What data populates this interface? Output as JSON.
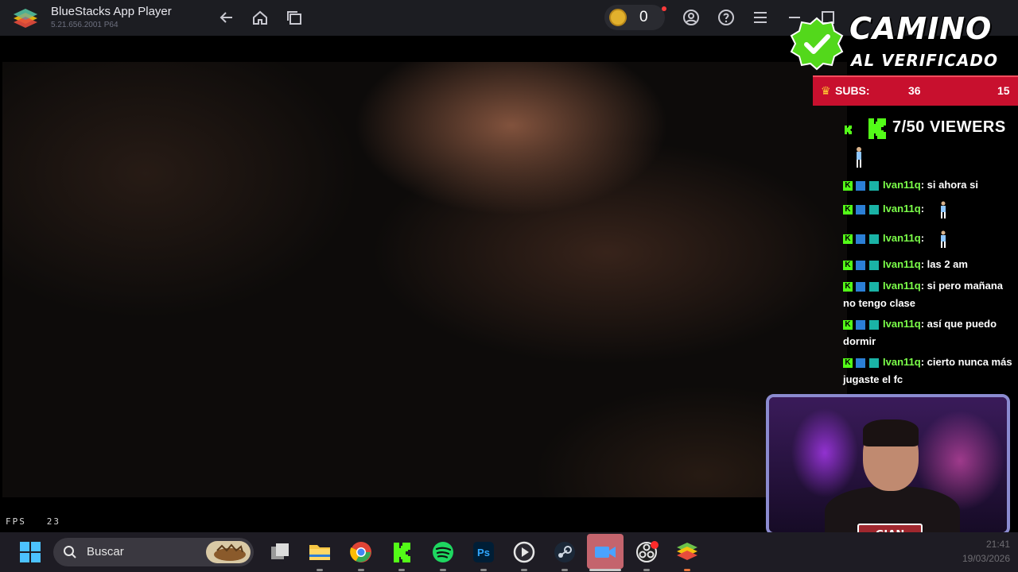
{
  "window": {
    "title": "BlueStacks App Player",
    "version": "5.21.656.2001 P64"
  },
  "toolbar": {
    "coins": "0"
  },
  "game": {
    "fps_label": "FPS",
    "fps_value": "23"
  },
  "overlay": {
    "title_line1": "CAMINO",
    "title_line2": "AL VERIFICADO",
    "subs_label": "SUBS:",
    "subs_value": "36",
    "subs_goal": "15",
    "viewers": "7/50 VIEWERS"
  },
  "chat": {
    "messages": [
      {
        "user": "Ivan11q",
        "text": ": si ahora si"
      },
      {
        "user": "Ivan11q",
        "text": ":"
      },
      {
        "user": "Ivan11q",
        "text": ":"
      },
      {
        "user": "Ivan11q",
        "text": ": las 2 am"
      },
      {
        "user": "Ivan11q",
        "text": ": si pero mañana no tengo clase"
      },
      {
        "user": "Ivan11q",
        "text": ": así que puedo dormir"
      },
      {
        "user": "Ivan11q",
        "text": ": cierto nunca más jugaste el fc"
      }
    ]
  },
  "webcam": {
    "name": "GIAN OVER"
  },
  "taskbar": {
    "search_placeholder": "Buscar",
    "time": "21:41",
    "date": "19/03/2026",
    "apps": [
      "windows-start",
      "task-view",
      "file-explorer",
      "chrome",
      "kick",
      "spotify",
      "photoshop",
      "media-player",
      "steam",
      "zoom",
      "obs",
      "bluestacks"
    ]
  },
  "colors": {
    "accent_green": "#53fc18",
    "subs_red": "#c8102e",
    "titlebar": "#1c1d22",
    "taskbar": "#1e1c24"
  }
}
